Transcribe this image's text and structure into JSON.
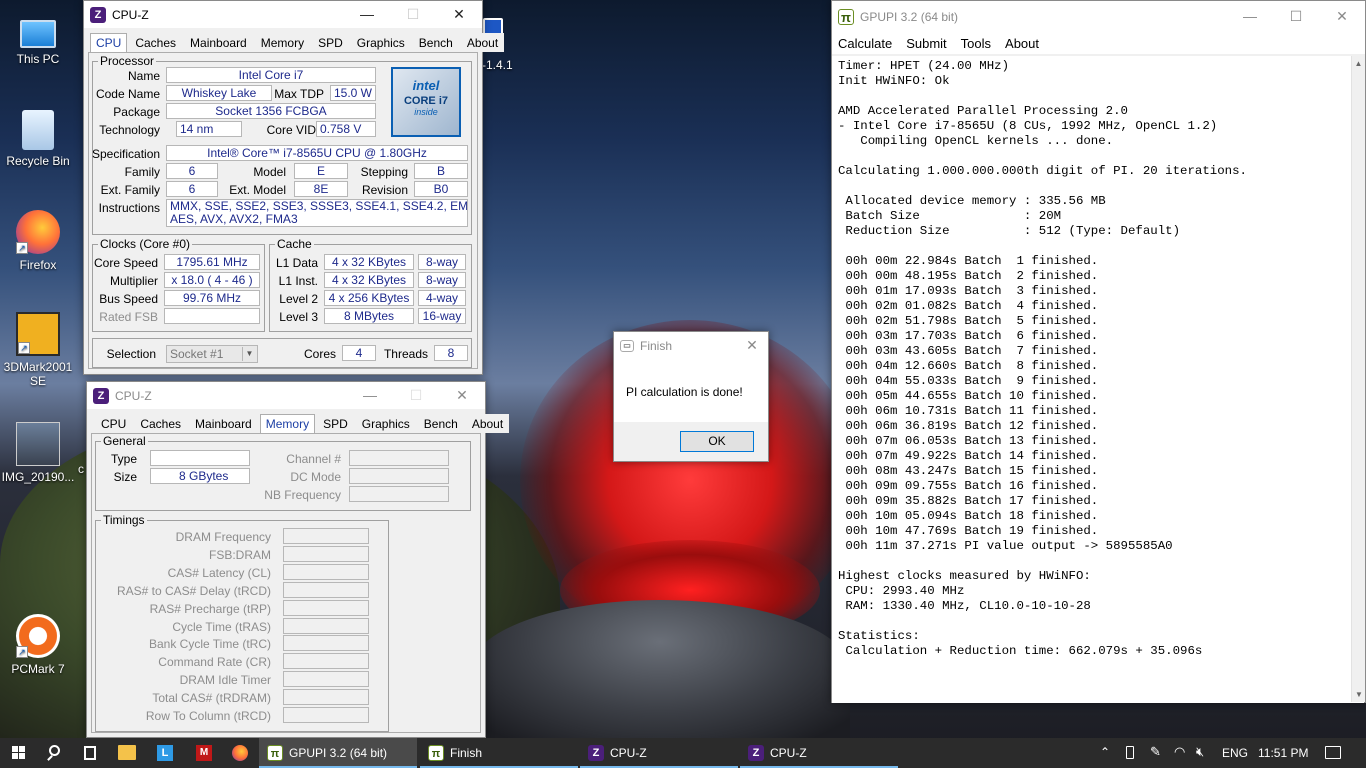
{
  "desktop": {
    "icons": [
      {
        "label": "This PC",
        "icon": "computer-icon"
      },
      {
        "label": "Recycle Bin",
        "icon": "recycle-bin-icon"
      },
      {
        "label": "Firefox",
        "icon": "firefox-icon"
      },
      {
        "label": "3DMark2001 SE",
        "icon": "3dmark-icon"
      },
      {
        "label": "IMG_20190...",
        "icon": "image-file-icon"
      },
      {
        "label": "PCMark 7",
        "icon": "pcmark-icon"
      }
    ],
    "partial": {
      "text_right": "-1.4.1",
      "text_c": "c"
    }
  },
  "cpuz_cpu": {
    "title": "CPU-Z",
    "active_tab": "CPU",
    "tabs": [
      "CPU",
      "Caches",
      "Mainboard",
      "Memory",
      "SPD",
      "Graphics",
      "Bench",
      "About"
    ],
    "processor": {
      "legend": "Processor",
      "name_label": "Name",
      "name": "Intel Core i7",
      "code_name_label": "Code Name",
      "code_name": "Whiskey Lake",
      "max_tdp_label": "Max TDP",
      "max_tdp": "15.0 W",
      "package_label": "Package",
      "package": "Socket 1356 FCBGA",
      "technology_label": "Technology",
      "technology": "14 nm",
      "core_vid_label": "Core VID",
      "core_vid": "0.758 V",
      "specification_label": "Specification",
      "specification": "Intel® Core™ i7-8565U CPU @ 1.80GHz",
      "family_label": "Family",
      "family": "6",
      "model_label": "Model",
      "model": "E",
      "stepping_label": "Stepping",
      "stepping": "B",
      "ext_family_label": "Ext. Family",
      "ext_family": "6",
      "ext_model_label": "Ext. Model",
      "ext_model": "8E",
      "revision_label": "Revision",
      "revision": "B0",
      "instructions_label": "Instructions",
      "instructions_line1": "MMX, SSE, SSE2, SSE3, SSSE3, SSE4.1, SSE4.2, EM64T, VT-x,",
      "instructions_line2": "AES, AVX, AVX2, FMA3",
      "logo": {
        "brand": "intel",
        "line1": "CORE i7",
        "line2": "inside"
      }
    },
    "clocks": {
      "legend": "Clocks (Core #0)",
      "core_speed_label": "Core Speed",
      "core_speed": "1795.61 MHz",
      "multiplier_label": "Multiplier",
      "multiplier": "x 18.0 ( 4 - 46 )",
      "bus_speed_label": "Bus Speed",
      "bus_speed": "99.76 MHz",
      "rated_fsb_label": "Rated FSB"
    },
    "cache": {
      "legend": "Cache",
      "rows": [
        {
          "label": "L1 Data",
          "size": "4 x 32 KBytes",
          "way": "8-way"
        },
        {
          "label": "L1 Inst.",
          "size": "4 x 32 KBytes",
          "way": "8-way"
        },
        {
          "label": "Level 2",
          "size": "4 x 256 KBytes",
          "way": "4-way"
        },
        {
          "label": "Level 3",
          "size": "8 MBytes",
          "way": "16-way"
        }
      ]
    },
    "selection_label": "Selection",
    "selection": "Socket #1",
    "cores_label": "Cores",
    "cores": "4",
    "threads_label": "Threads",
    "threads": "8"
  },
  "cpuz_mem": {
    "title": "CPU-Z",
    "active_tab": "Memory",
    "tabs": [
      "CPU",
      "Caches",
      "Mainboard",
      "Memory",
      "SPD",
      "Graphics",
      "Bench",
      "About"
    ],
    "general": {
      "legend": "General",
      "type_label": "Type",
      "size_label": "Size",
      "size": "8 GBytes",
      "channel_label": "Channel #",
      "dc_mode_label": "DC Mode",
      "nb_frequency_label": "NB Frequency"
    },
    "timings": {
      "legend": "Timings",
      "rows": [
        "DRAM Frequency",
        "FSB:DRAM",
        "CAS# Latency (CL)",
        "RAS# to CAS# Delay (tRCD)",
        "RAS# Precharge (tRP)",
        "Cycle Time (tRAS)",
        "Bank Cycle Time (tRC)",
        "Command Rate (CR)",
        "DRAM Idle Timer",
        "Total CAS# (tRDRAM)",
        "Row To Column (tRCD)"
      ]
    }
  },
  "finish_dialog": {
    "title": "Finish",
    "message": "PI calculation is done!",
    "ok_label": "OK"
  },
  "gpupi": {
    "title": "GPUPI 3.2 (64 bit)",
    "menu": [
      "Calculate",
      "Submit",
      "Tools",
      "About"
    ],
    "console": "Timer: HPET (24.00 MHz)\nInit HWiNFO: Ok\n\nAMD Accelerated Parallel Processing 2.0\n- Intel Core i7-8565U (8 CUs, 1992 MHz, OpenCL 1.2)\n   Compiling OpenCL kernels ... done.\n\nCalculating 1.000.000.000th digit of PI. 20 iterations.\n\n Allocated device memory : 335.56 MB\n Batch Size              : 20M\n Reduction Size          : 512 (Type: Default)\n\n 00h 00m 22.984s Batch  1 finished.\n 00h 00m 48.195s Batch  2 finished.\n 00h 01m 17.093s Batch  3 finished.\n 00h 02m 01.082s Batch  4 finished.\n 00h 02m 51.798s Batch  5 finished.\n 00h 03m 17.703s Batch  6 finished.\n 00h 03m 43.605s Batch  7 finished.\n 00h 04m 12.660s Batch  8 finished.\n 00h 04m 55.033s Batch  9 finished.\n 00h 05m 44.655s Batch 10 finished.\n 00h 06m 10.731s Batch 11 finished.\n 00h 06m 36.819s Batch 12 finished.\n 00h 07m 06.053s Batch 13 finished.\n 00h 07m 49.922s Batch 14 finished.\n 00h 08m 43.247s Batch 15 finished.\n 00h 09m 09.755s Batch 16 finished.\n 00h 09m 35.882s Batch 17 finished.\n 00h 10m 05.094s Batch 18 finished.\n 00h 10m 47.769s Batch 19 finished.\n 00h 11m 37.271s PI value output -> 5895585A0\n\nHighest clocks measured by HWiNFO:\n CPU: 2993.40 MHz\n RAM: 1330.40 MHz, CL10.0-10-10-28\n\nStatistics:\n Calculation + Reduction time: 662.079s + 35.096s"
  },
  "taskbar": {
    "items": [
      {
        "label": "GPUPI 3.2 (64 bit)",
        "icon": "gpupi-icon",
        "active": true
      },
      {
        "label": "Finish",
        "icon": "finish-icon",
        "active": false
      },
      {
        "label": "CPU-Z",
        "icon": "cpuz-icon",
        "active": false
      },
      {
        "label": "CPU-Z",
        "icon": "cpuz-icon",
        "active": false
      }
    ],
    "language": "ENG",
    "clock": "11:51 PM"
  },
  "colors": {
    "value_text": "#1e2a8c",
    "tab_active": "#1c3fa5",
    "taskbar": "#2b2b2b",
    "accent": "#76b9ed"
  }
}
